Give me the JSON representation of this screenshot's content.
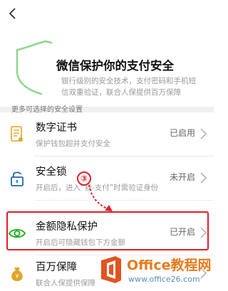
{
  "hero": {
    "title": "微信保护你的支付安全",
    "description": "银行级别的安全技术，支付密码和手机短信双重验证，联合人保提供百万保障"
  },
  "section_label": "更多可选择的安全设置",
  "settings": [
    {
      "title": "数字证书",
      "subtitle": "保护钱包超并支付安全",
      "status": "已启用",
      "icon": "certificate-icon"
    },
    {
      "title": "安全锁",
      "subtitle": "开启后，进入“我-支付”时需验证身份",
      "status": "未开启",
      "icon": "lock-icon"
    },
    {
      "title": "金额隐私保护",
      "subtitle": "开启后可隐藏钱包下方金额",
      "status": "已开启",
      "icon": "eye-icon"
    },
    {
      "title": "百万保障",
      "subtitle": "联合人保提供保障",
      "status": "",
      "icon": "money-bag-icon"
    }
  ],
  "annotation": {
    "step": "③",
    "color": "#e0202a"
  },
  "watermark": {
    "name": "Office教程网",
    "url": "www.office26.com"
  },
  "colors": {
    "accent_green": "#1aad19",
    "gold": "#e0a526",
    "highlight_red": "#e0202a"
  }
}
